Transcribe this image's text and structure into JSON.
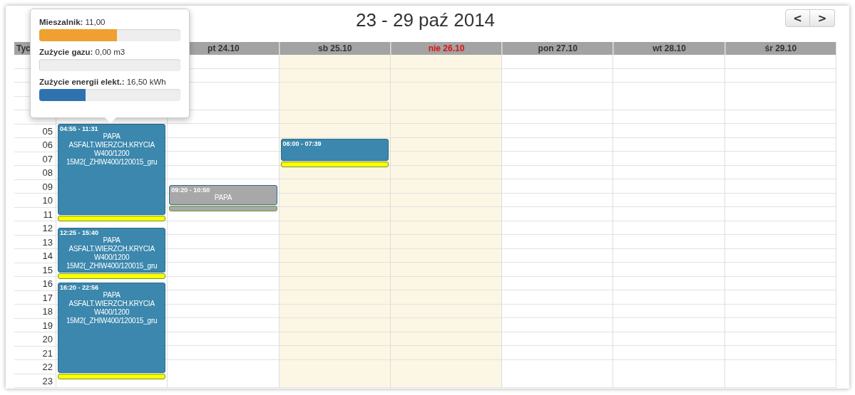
{
  "title": "23 - 29 paź 2014",
  "nav_buttons": [
    {
      "label": "<"
    },
    {
      "label": ">"
    }
  ],
  "time_column": {
    "header": "Tyc",
    "hours": [
      "05",
      "06",
      "07",
      "08",
      "09",
      "10",
      "11",
      "12",
      "13",
      "14",
      "15",
      "16",
      "17",
      "18",
      "19",
      "20",
      "21",
      "22",
      "23"
    ]
  },
  "days": [
    {
      "kind": "weekday",
      "events": [
        {
          "kind": "job",
          "color": "#3b87ad",
          "time": "04:55 - 11:31",
          "lines": [
            "PAPA",
            "ASFALT.WIERZCH.KRYCIA",
            "W400/1200",
            "15M2(_ZHIW400/120015_gru"
          ]
        },
        {
          "kind": "marker",
          "color": "#ffff00"
        },
        {
          "kind": "job",
          "color": "#3b87ad",
          "time": "12:25 - 15:40",
          "lines": [
            "PAPA",
            "ASFALT.WIERZCH.KRYCIA",
            "W400/1200",
            "15M2(_ZHIW400/120015_gru"
          ]
        },
        {
          "kind": "marker",
          "color": "#ffff00"
        },
        {
          "kind": "job",
          "color": "#3b87ad",
          "time": "16:20 - 22:56",
          "lines": [
            "PAPA",
            "ASFALT.WIERZCH.KRYCIA",
            "W400/1200",
            "15M2(_ZHIW400/120015_gru"
          ]
        },
        {
          "kind": "marker",
          "color": "#ffff00"
        }
      ]
    },
    {
      "kind": "weekday",
      "label": "pt 24.10",
      "events": [
        {
          "kind": "job",
          "color": "#a8a8a8",
          "time": "09:20 - 10:50",
          "lines": [
            "PAPA"
          ]
        },
        {
          "kind": "marker",
          "color": "#a8a8a8"
        }
      ]
    },
    {
      "kind": "saturday",
      "label": "sb 25.10",
      "events": [
        {
          "kind": "job",
          "color": "#3b87ad",
          "time": "06:00 - 07:39"
        },
        {
          "kind": "marker",
          "color": "#ffff00"
        }
      ]
    },
    {
      "kind": "sunday",
      "label": "nie 26.10"
    },
    {
      "kind": "weekday",
      "label": "pon 27.10"
    },
    {
      "kind": "weekday",
      "label": "wt 28.10"
    },
    {
      "kind": "weekday",
      "label": "śr 29.10"
    }
  ],
  "popover": {
    "meters": [
      {
        "label": "**Mieszalnik:** 11,00",
        "level": 0.55,
        "color": "#f0a030"
      },
      {
        "label": "**Zużycie gazu:** 0,00 m3",
        "level": 0
      },
      {
        "label": "**Zużycie energii elekt.:** 16,50 kWh",
        "level": 0.33,
        "color": "#2f72b0"
      }
    ]
  }
}
